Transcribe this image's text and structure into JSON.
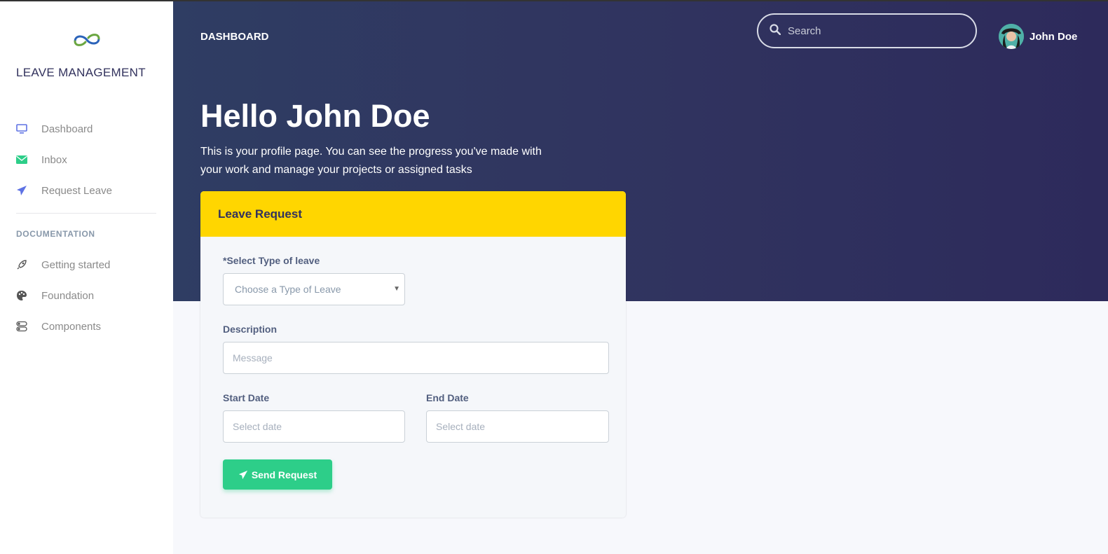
{
  "sidebar": {
    "brand_name": "LEAVE MANAGEMENT",
    "items": [
      {
        "label": "Dashboard",
        "icon": "monitor-icon",
        "color": "#5e72e4"
      },
      {
        "label": "Inbox",
        "icon": "envelope-icon",
        "color": "#2dce89"
      },
      {
        "label": "Request Leave",
        "icon": "paper-plane-icon",
        "color": "#5e72e4"
      }
    ],
    "docs_heading": "DOCUMENTATION",
    "docs": [
      {
        "label": "Getting started",
        "icon": "rocket-icon"
      },
      {
        "label": "Foundation",
        "icon": "palette-icon"
      },
      {
        "label": "Components",
        "icon": "ui-components-icon"
      }
    ]
  },
  "header": {
    "title": "DASHBOARD",
    "search_placeholder": "Search",
    "user_name": "John Doe",
    "greeting": "Hello John Doe",
    "intro": "This is your profile page. You can see the progress you've made with your work and manage your projects or assigned tasks"
  },
  "form": {
    "title": "Leave Request",
    "type_label": "*Select Type of leave",
    "type_value": "Choose a Type of Leave",
    "description_label": "Description",
    "description_placeholder": "Message",
    "start_label": "Start Date",
    "start_placeholder": "Select date",
    "end_label": "End Date",
    "end_placeholder": "Select date",
    "submit_label": "Send Request"
  },
  "colors": {
    "hero": "#30335f",
    "card_header": "#ffd600",
    "button": "#2dce89"
  }
}
